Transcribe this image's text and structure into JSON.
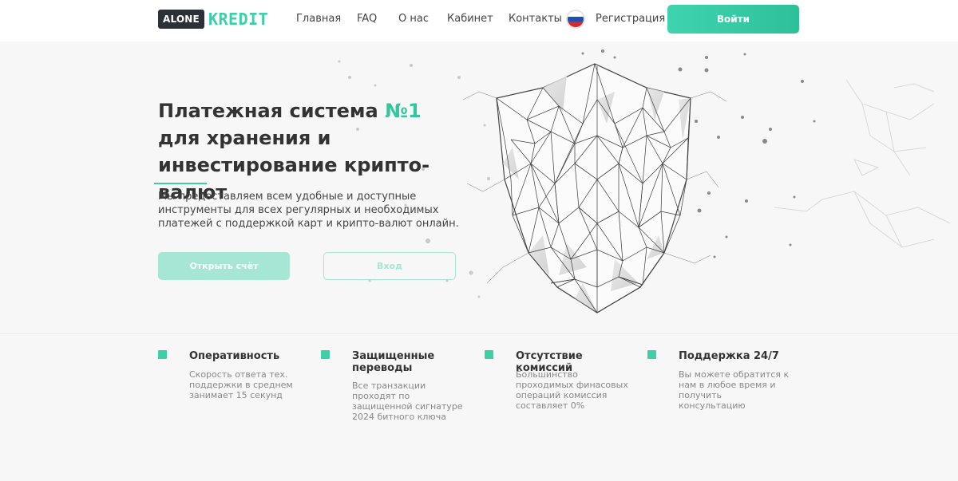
{
  "header": {
    "logo": {
      "left": "ALONE",
      "right": "KREDIT"
    },
    "nav": [
      "Главная",
      "FAQ",
      "О нас",
      "Кабинет",
      "Контакты"
    ],
    "language_flag": "russia-flag-icon",
    "register_label": "Регистрация",
    "login_label": "Войти"
  },
  "hero": {
    "title_part1": "Платежная система ",
    "title_accent": "№1",
    "title_part2": " для хранения и инвестирование крипто-валют",
    "description": "Мы предоставляем всем удобные и доступные инструменты для всех регулярных и необходимых платежей с поддержкой карт и крипто-валют онлайн.",
    "open_account_label": "Открыть счёт",
    "enter_label": "Вход"
  },
  "features": [
    {
      "title": "Оперативность",
      "description": "Скорость ответа тех. поддержки в среднем занимает 15 секунд"
    },
    {
      "title": "Защищенные переводы",
      "description": "Все транзакции проходят по защищенной сигнатуре 2024 битного ключа"
    },
    {
      "title": "Отсутствие комиссий",
      "description": "Большинство проходимых финасовых операций комиссия составляет 0%"
    },
    {
      "title": "Поддержка 24/7",
      "description": "Вы можете обратится к нам в любое время и получить консультацию"
    }
  ],
  "colors": {
    "accent": "#3ccfa8",
    "accent_light": "#a6e6d4",
    "dark": "#2c3138",
    "text": "#333333"
  }
}
